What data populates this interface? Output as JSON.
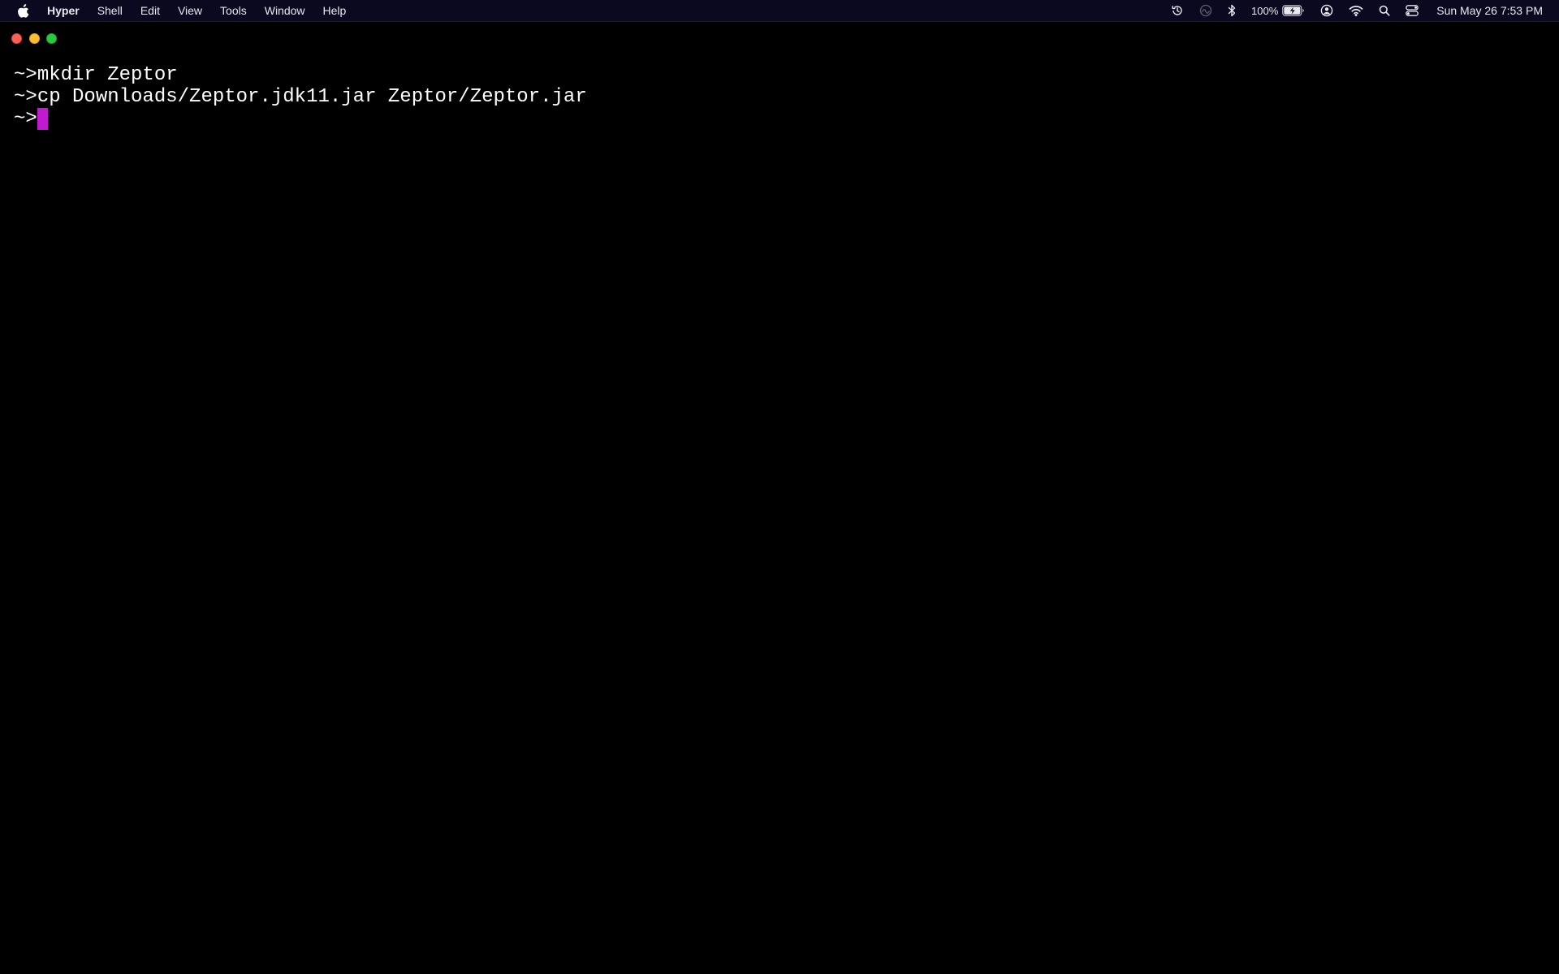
{
  "menubar": {
    "apple_icon": "apple-logo-icon",
    "app_name": "Hyper",
    "menus": [
      "Shell",
      "Edit",
      "View",
      "Tools",
      "Window",
      "Help"
    ],
    "status_icons": [
      "time-machine-icon",
      "siri-icon",
      "bluetooth-icon",
      "battery-icon",
      "user-icon",
      "wifi-icon",
      "spotlight-search-icon",
      "control-center-icon"
    ],
    "battery_percent": "100%",
    "clock": "Sun May 26  7:53 PM"
  },
  "window": {
    "controls": [
      "close",
      "minimize",
      "zoom"
    ],
    "colors": {
      "close": "#ff5f57",
      "minimize": "#febc2e",
      "zoom": "#28c840"
    }
  },
  "terminal": {
    "prompt": "~>",
    "cursor_color": "#c11bd1",
    "lines": [
      {
        "prompt": "~>",
        "command": "mkdir Zeptor"
      },
      {
        "prompt": "~>",
        "command": "cp Downloads/Zeptor.jdk11.jar Zeptor/Zeptor.jar"
      },
      {
        "prompt": "~>",
        "command": ""
      }
    ]
  }
}
